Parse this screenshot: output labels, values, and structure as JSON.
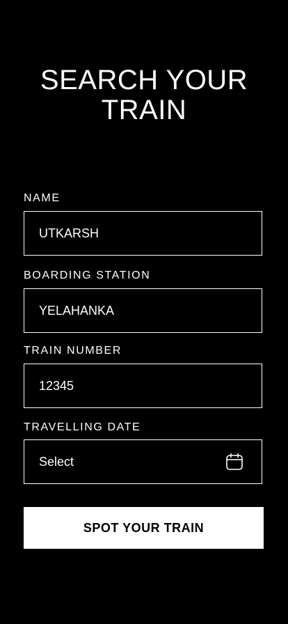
{
  "header": {
    "title_line1": "SEARCH YOUR",
    "title_line2": "TRAIN"
  },
  "form": {
    "name": {
      "label": "NAME",
      "value": "UTKARSH"
    },
    "boarding_station": {
      "label": "BOARDING STATION",
      "value": "YELAHANKA"
    },
    "train_number": {
      "label": "TRAIN NUMBER",
      "value": "12345"
    },
    "travelling_date": {
      "label": "TRAVELLING DATE",
      "value": "Select",
      "icon": "calendar-icon"
    }
  },
  "actions": {
    "submit_label": "SPOT YOUR TRAIN"
  },
  "colors": {
    "background": "#000000",
    "foreground": "#ffffff"
  }
}
